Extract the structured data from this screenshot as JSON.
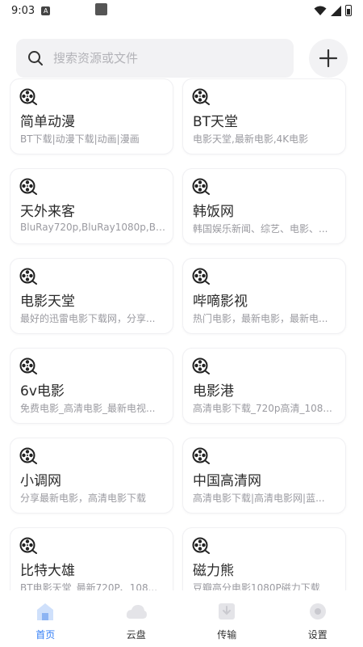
{
  "status_bar": {
    "time": "9:03",
    "notif_letter": "A"
  },
  "search": {
    "placeholder": "搜索资源或文件"
  },
  "cards": [
    {
      "title": "简单动漫",
      "desc": "BT下载|动漫下载|动画|漫画"
    },
    {
      "title": "BT天堂",
      "desc": "电影天堂,最新电影,4K电影"
    },
    {
      "title": "天外来客",
      "desc": "BluRay720p,BluRay1080p,Blu..."
    },
    {
      "title": "韩饭网",
      "desc": "韩国娱乐新闻、综艺、电影、..."
    },
    {
      "title": "电影天堂",
      "desc": "最好的迅雷电影下载网，分享..."
    },
    {
      "title": "哔嘀影视",
      "desc": "热门电影，最新电影，最新电..."
    },
    {
      "title": "6v电影",
      "desc": "免费电影_高清电影_最新电视..."
    },
    {
      "title": "电影港",
      "desc": "高清电影下载_720p高清_108..."
    },
    {
      "title": "小调网",
      "desc": "分享最新电影，高清电影下载"
    },
    {
      "title": "中国高清网",
      "desc": "高清电影下载|高清电影网|蓝..."
    },
    {
      "title": "比特大雄",
      "desc": "BT电影天堂_最新720P、108..."
    },
    {
      "title": "磁力熊",
      "desc": "豆瓣高分电影1080P磁力下载"
    }
  ],
  "nav": [
    {
      "label": "首页",
      "icon": "home-icon"
    },
    {
      "label": "云盘",
      "icon": "cloud-icon"
    },
    {
      "label": "传输",
      "icon": "transfer-icon"
    },
    {
      "label": "设置",
      "icon": "settings-icon"
    }
  ],
  "colors": {
    "accent": "#2f7cf6",
    "card_border": "#f0f0f3",
    "search_bg": "#f2f2f4"
  }
}
